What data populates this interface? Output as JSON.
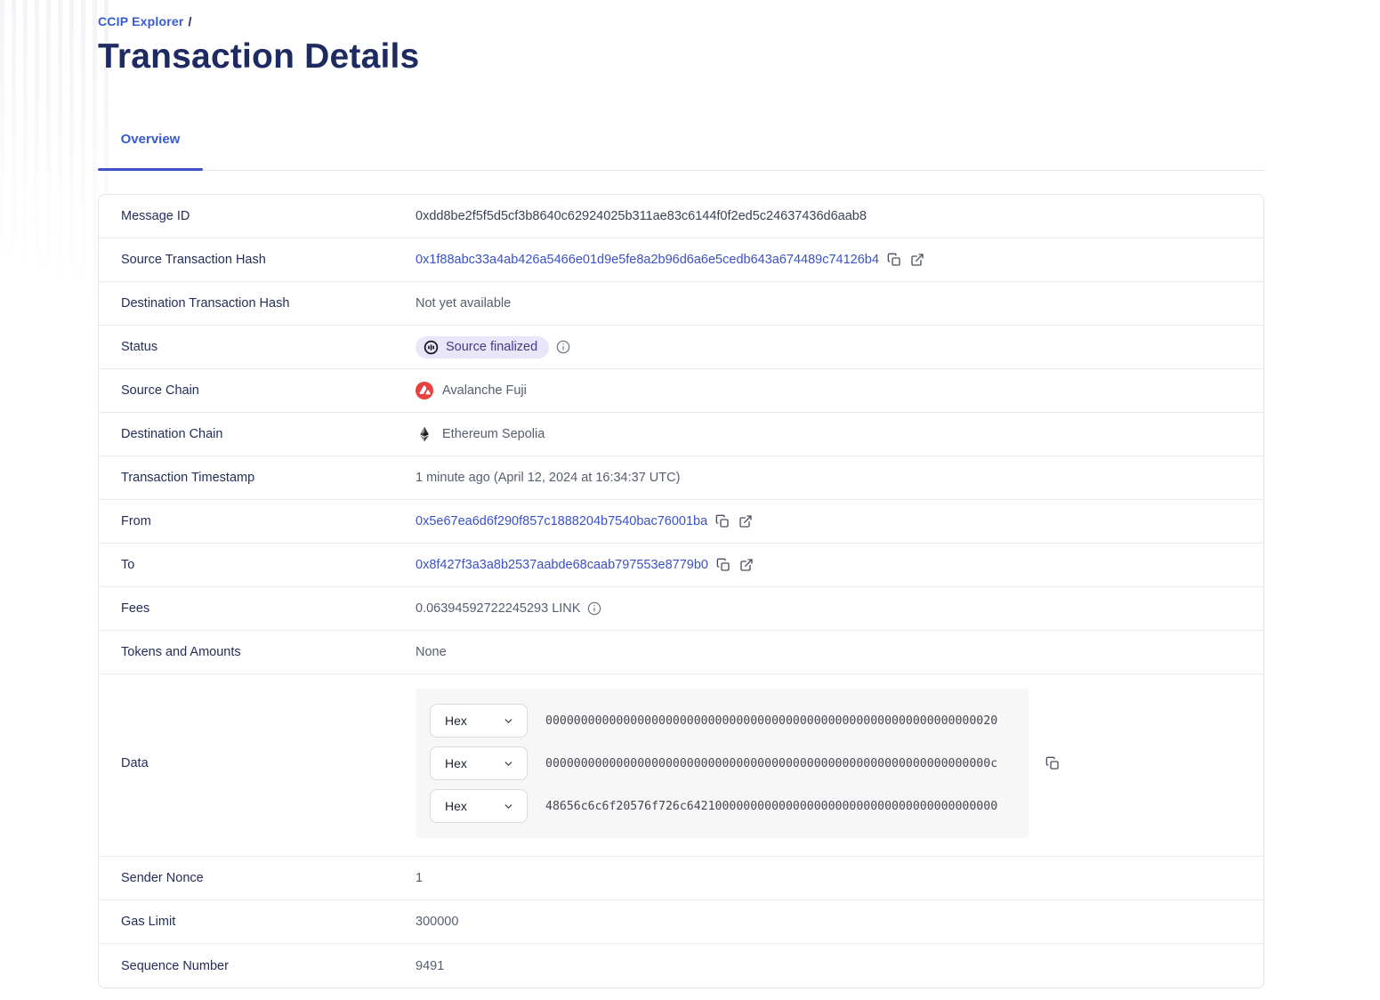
{
  "breadcrumb": {
    "root": "CCIP Explorer",
    "separator": "/"
  },
  "page_title": "Transaction Details",
  "tabs": [
    {
      "label": "Overview",
      "active": true
    }
  ],
  "colors": {
    "accent_blue": "#375bd2",
    "title_navy": "#1e2b63",
    "link_blue": "#3a51c8",
    "badge_bg": "#e9e6fa",
    "badge_text": "#423a85",
    "avalanche_red": "#e84142"
  },
  "icons": {
    "status_badge": "progress-circle-icon",
    "source_chain": "avalanche-icon",
    "destination_chain": "ethereum-icon",
    "link_actions": [
      "copy-icon",
      "external-link-icon"
    ],
    "info": "info-icon",
    "select": "chevron-down-icon"
  },
  "rows": [
    {
      "label": "Message ID",
      "value": "0xdd8be2f5f5d5cf3b8640c62924025b311ae83c6144f0f2ed5c24637436d6aab8"
    },
    {
      "label": "Source Transaction Hash",
      "value": "0x1f88abc33a4ab426a5466e01d9e5fe8a2b96d6a6e5cedb643a674489c74126b4"
    },
    {
      "label": "Destination Transaction Hash",
      "value": "Not yet available"
    },
    {
      "label": "Status",
      "value": "Source finalized"
    },
    {
      "label": "Source Chain",
      "value": "Avalanche Fuji"
    },
    {
      "label": "Destination Chain",
      "value": "Ethereum Sepolia"
    },
    {
      "label": "Transaction Timestamp",
      "value": "1 minute ago (April 12, 2024 at 16:34:37 UTC)"
    },
    {
      "label": "From",
      "value": "0x5e67ea6d6f290f857c1888204b7540bac76001ba"
    },
    {
      "label": "To",
      "value": "0x8f427f3a3a8b2537aabde68caab797553e8779b0"
    },
    {
      "label": "Fees",
      "value": "0.06394592722245293 LINK"
    },
    {
      "label": "Tokens and Amounts",
      "value": "None"
    },
    {
      "label": "Data",
      "lines": [
        {
          "format_selector": "Hex",
          "value": "0000000000000000000000000000000000000000000000000000000000000020"
        },
        {
          "format_selector": "Hex",
          "value": "000000000000000000000000000000000000000000000000000000000000000c"
        },
        {
          "format_selector": "Hex",
          "value": "48656c6c6f20576f726c64210000000000000000000000000000000000000000"
        }
      ]
    },
    {
      "label": "Sender Nonce",
      "value": "1"
    },
    {
      "label": "Gas Limit",
      "value": "300000"
    },
    {
      "label": "Sequence Number",
      "value": "9491"
    }
  ]
}
